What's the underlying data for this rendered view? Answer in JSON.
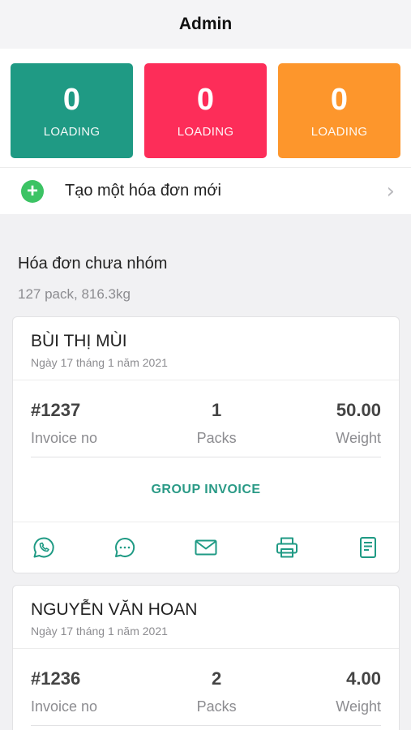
{
  "header": {
    "title": "Admin"
  },
  "stats": [
    {
      "value": "0",
      "label": "LOADING",
      "color": "#1f9a84"
    },
    {
      "value": "0",
      "label": "LOADING",
      "color": "#fd2d59"
    },
    {
      "value": "0",
      "label": "LOADING",
      "color": "#fd962c"
    }
  ],
  "create": {
    "label": "Tạo một hóa đơn mới",
    "icon": "plus-circle-icon",
    "chevron": "›"
  },
  "section": {
    "title": "Hóa đơn chưa nhóm",
    "summary": "127 pack, 816.3kg"
  },
  "invoices": [
    {
      "customer": "BÙI THỊ MÙI",
      "date": "Ngày 17 tháng 1 năm 2021",
      "invoice_no": "#1237",
      "invoice_label": "Invoice no",
      "packs": "1",
      "packs_label": "Packs",
      "weight": "50.00",
      "weight_label": "Weight",
      "group_label": "GROUP INVOICE"
    },
    {
      "customer": "NGUYỄN VĂN HOAN",
      "date": "Ngày 17 tháng 1 năm 2021",
      "invoice_no": "#1236",
      "invoice_label": "Invoice no",
      "packs": "2",
      "packs_label": "Packs",
      "weight": "4.00",
      "weight_label": "Weight"
    }
  ],
  "accent": "#1f9a84"
}
